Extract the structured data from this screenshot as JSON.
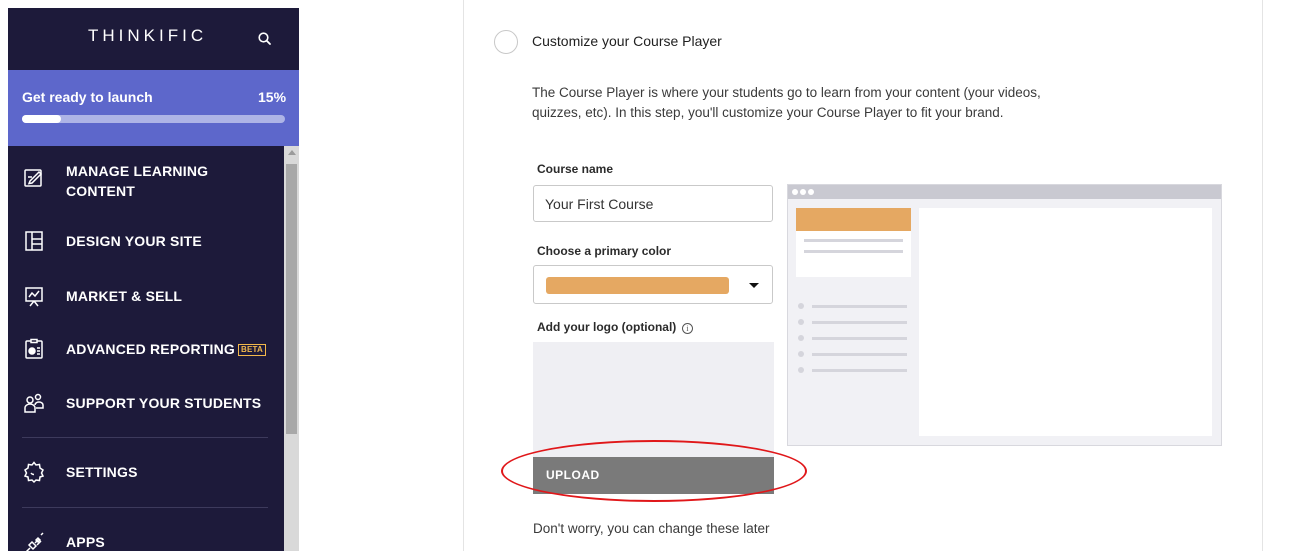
{
  "brand": {
    "name": "THINKIFIC"
  },
  "launch": {
    "title": "Get ready to launch",
    "percent_label": "15%",
    "progress": 0.15
  },
  "nav": {
    "items": [
      {
        "label": "MANAGE LEARNING CONTENT",
        "icon": "edit-content-icon"
      },
      {
        "label": "DESIGN YOUR SITE",
        "icon": "layout-icon"
      },
      {
        "label": "MARKET & SELL",
        "icon": "presentation-chart-icon"
      },
      {
        "label": "ADVANCED REPORTING",
        "badge": "BETA",
        "icon": "report-clipboard-icon"
      },
      {
        "label": "SUPPORT YOUR STUDENTS",
        "icon": "users-icon"
      },
      {
        "label": "SETTINGS",
        "icon": "gear-icon"
      },
      {
        "label": "APPS",
        "icon": "plug-icon"
      }
    ]
  },
  "step": {
    "title": "Customize your Course Player",
    "description": "The Course Player is where your students go to learn from your content (your videos, quizzes, etc). In this step, you'll customize your Course Player to fit your brand."
  },
  "form": {
    "course_name_label": "Course name",
    "course_name_value": "Your First Course",
    "color_label": "Choose a primary color",
    "primary_color": "#e5a862",
    "logo_label": "Add your logo (optional)",
    "info_glyph": "i",
    "upload_label": "UPLOAD",
    "footer_note": "Don't worry, you can change these later"
  },
  "colors": {
    "sidebar_bg": "#1d1a3a",
    "launch_bg": "#5d67cb",
    "beta_badge": "#f2b84b",
    "annotation": "#e0171a"
  }
}
